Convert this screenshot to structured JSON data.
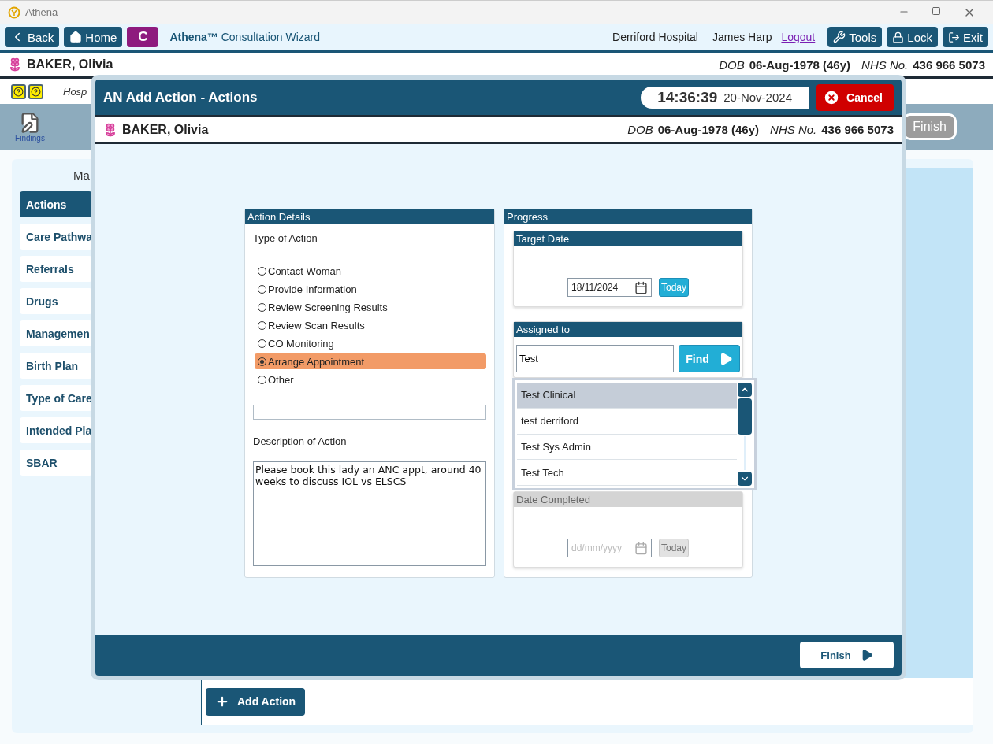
{
  "window": {
    "title": "Athena"
  },
  "toolbar": {
    "nav": [
      {
        "label": "Back",
        "kind": "back"
      },
      {
        "label": "Home",
        "kind": "home"
      },
      {
        "label": "C",
        "kind": "letter"
      }
    ],
    "app_title": "**Athena™** Consultation Wizard",
    "hospital": "Derriford Hospital",
    "user": "James Harp",
    "logout": "Logout",
    "actions": [
      {
        "label": "Tools",
        "kind": "tools"
      },
      {
        "label": "Lock",
        "kind": "lock"
      },
      {
        "label": "Exit",
        "kind": "exit"
      }
    ]
  },
  "patient": {
    "name": "BAKER, Olivia",
    "dob_label": "DOB",
    "dob": "06-Aug-1978 (46y)",
    "nhs_label": "NHS No.",
    "nhs": "436 966 5073"
  },
  "info_row": {
    "text": "Hosp"
  },
  "ribbon": {
    "findings": "Findings",
    "finish": {
      "label": "Finish",
      "disabled": true
    }
  },
  "manage": {
    "heading": "Ma",
    "items": [
      {
        "label": "Actions",
        "selected": true
      },
      {
        "label": "Care Pathwa",
        "selected": false
      },
      {
        "label": "Referrals",
        "selected": false
      },
      {
        "label": "Drugs",
        "selected": false
      },
      {
        "label": "Managemen",
        "selected": false
      },
      {
        "label": "Birth Plan",
        "selected": false
      },
      {
        "label": "Type of Care",
        "selected": false
      },
      {
        "label": "Intended Pla",
        "selected": false
      },
      {
        "label": "SBAR",
        "selected": false
      }
    ]
  },
  "add_action": "Add Action",
  "dialog": {
    "title": "AN Add Action - Actions",
    "time": "14:36:39",
    "date": "20-Nov-2024",
    "cancel": "Cancel",
    "patient": {
      "name": "BAKER, Olivia",
      "dob_label": "DOB",
      "dob": "06-Aug-1978 (46y)",
      "nhs_label": "NHS No.",
      "nhs": "436 966 5073"
    },
    "action_details": {
      "title": "Action Details",
      "type_label": "Type of Action",
      "options": [
        {
          "label": "Contact Woman",
          "selected": false
        },
        {
          "label": "Provide Information",
          "selected": false
        },
        {
          "label": "Review Screening Results",
          "selected": false
        },
        {
          "label": "Review Scan Results",
          "selected": false
        },
        {
          "label": "CO Monitoring",
          "selected": false
        },
        {
          "label": "Arrange Appointment",
          "selected": true
        },
        {
          "label": "Other",
          "selected": false
        }
      ],
      "description_label": "Description of Action",
      "description": "Please book this lady an ANC appt, around 40 weeks to discuss IOL vs ELSCS"
    },
    "progress": {
      "title": "Progress",
      "target_date": {
        "title": "Target Date",
        "value": "18/11/2024",
        "today": "Today",
        "disabled": false
      },
      "assigned": {
        "title": "Assigned to",
        "value": "Test",
        "find": "Find",
        "results": [
          {
            "label": "Test Clinical",
            "selected": true
          },
          {
            "label": "test derriford",
            "selected": false
          },
          {
            "label": "Test Sys Admin",
            "selected": false
          },
          {
            "label": "Test Tech",
            "selected": false
          }
        ]
      },
      "date_completed": {
        "title": "Date Completed",
        "placeholder": "dd/mm/yyyy",
        "today": "Today",
        "disabled": true
      }
    },
    "finish": "Finish"
  }
}
